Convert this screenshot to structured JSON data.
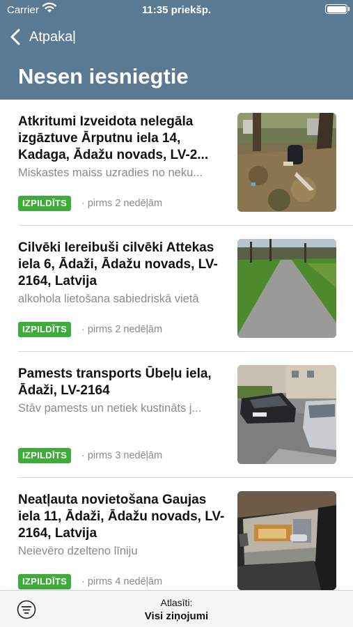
{
  "status_bar": {
    "carrier": "Carrier",
    "time": "11:35 priekšp."
  },
  "nav": {
    "back_label": "Atpakaļ",
    "title": "Nesen iesniegtie"
  },
  "reports": [
    {
      "title": "Atkritumi Izveidota nelegāla izgāztuve Ārputnu iela 14, Kadaga, Ādažu novads, LV-2...",
      "description": "Miskastes maiss uzradies no neku...",
      "status": "IZPILDĪTS",
      "time": "· pirms 2 nedēļām",
      "photo": "trash-bag-in-park-photo"
    },
    {
      "title": "Cilvēki Iereibuši cilvēki Attekas iela 6, Ādaži, Ādažu novads, LV-2164, Latvija",
      "description": "alkohola lietošana sabiedriskā vietā",
      "status": "IZPILDĪTS",
      "time": "· pirms 2 nedēļām",
      "photo": "park-footpath-photo"
    },
    {
      "title": "Pamests transports  Ūbeļu iela, Ādaži, LV-2164",
      "description": "Stāv pamests un netiek kustināts j...",
      "status": "IZPILDĪTS",
      "time": "· pirms 3 nedēļām",
      "photo": "parked-cars-photo"
    },
    {
      "title": "Neatļauta novietošana  Gaujas iela 11, Ādaži, Ādažu novads, LV-2164, Latvija",
      "description": "Neievēro dzelteno līniju",
      "status": "IZPILDĪTS",
      "time": "· pirms 4 nedēļām",
      "photo": "car-window-view-photo"
    }
  ],
  "toolbar": {
    "filter_caption": "Atlasīti:",
    "filter_value": "Visi ziņojumi",
    "filter_icon": "filter-icon"
  },
  "colors": {
    "header": "#5a7a93",
    "status_badge": "#3fab3a"
  }
}
